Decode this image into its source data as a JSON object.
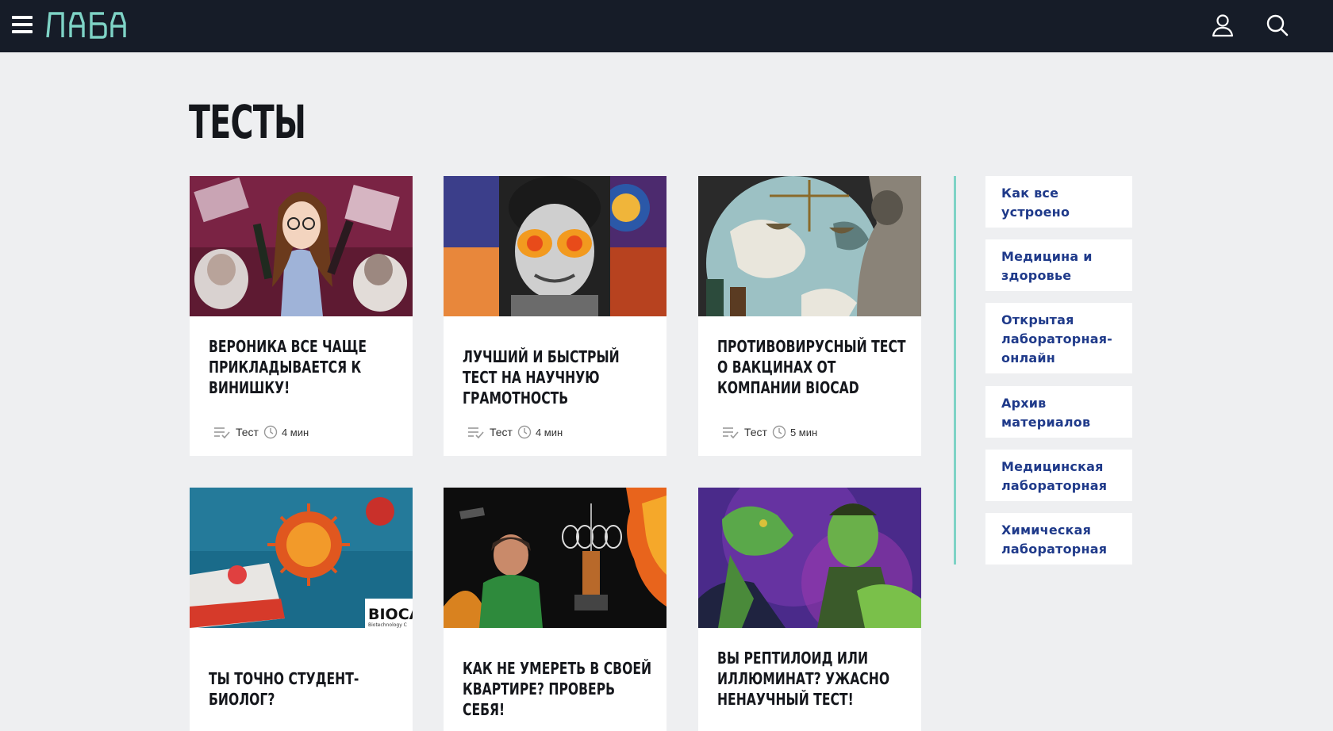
{
  "header": {
    "logo_alt": "ЛАБА",
    "accent": "#7ed3c6",
    "background": "#161c28"
  },
  "page": {
    "title": "ТЕСТЫ"
  },
  "cards": [
    {
      "title": "Вероника все чаще прикладывается к винишку!",
      "type": "Тест",
      "time": "4 мин"
    },
    {
      "title": "Лучший и быстрый тест на научную грамотность",
      "type": "Тест",
      "time": "4 мин"
    },
    {
      "title": "Противовирусный тест о вакцинах от компании BIOCAD",
      "type": "Тест",
      "time": "5 мин"
    },
    {
      "title": "Ты точно студент-биолог?",
      "badge": "BIOCA",
      "badge_sub": "Biotechnology C"
    },
    {
      "title": "Как не умереть в своей квартире? Проверь себя!"
    },
    {
      "title": "Вы рептилоид или иллюминат? Ужасно ненаучный тест!"
    }
  ],
  "sidebar": {
    "items": [
      {
        "label": "Как все устроено"
      },
      {
        "label": "Медицина и здоровье"
      },
      {
        "label": "Открытая лабораторная-онлайн"
      },
      {
        "label": "Архив материалов"
      },
      {
        "label": "Медицинская лабораторная"
      },
      {
        "label": "Химическая лабораторная"
      }
    ],
    "link_color": "#1f3a8a"
  },
  "icons": {
    "menu": "hamburger-icon",
    "user": "user-icon",
    "search": "search-icon",
    "type": "checklist-icon",
    "time": "clock-icon"
  }
}
